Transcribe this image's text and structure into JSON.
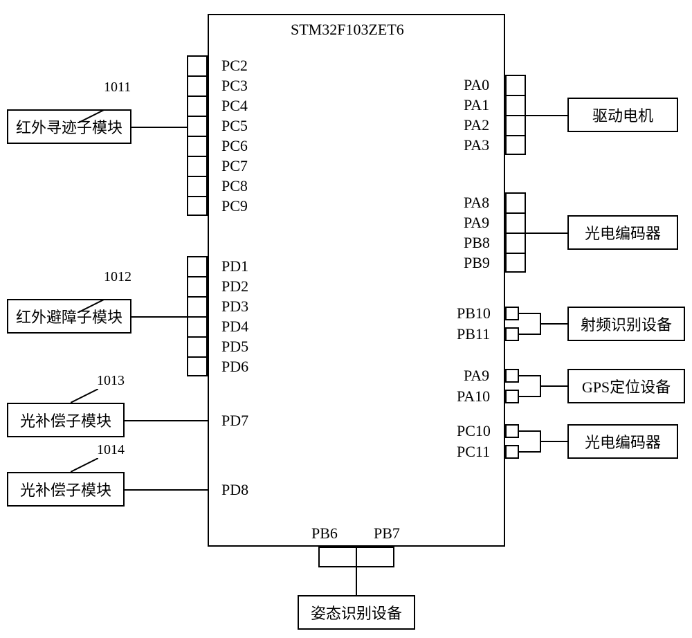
{
  "mcu": {
    "title": "STM32F103ZET6",
    "left_pins_pc": [
      "PC2",
      "PC3",
      "PC4",
      "PC5",
      "PC6",
      "PC7",
      "PC8",
      "PC9"
    ],
    "left_pins_pd_a": [
      "PD1",
      "PD2",
      "PD3",
      "PD4",
      "PD5",
      "PD6"
    ],
    "left_pin_pd7": "PD7",
    "left_pin_pd8": "PD8",
    "right_pins_pa_top": [
      "PA0",
      "PA1",
      "PA2",
      "PA3"
    ],
    "right_pins_enc": [
      "PA8",
      "PA9",
      "PB8",
      "PB9"
    ],
    "right_pins_rfid": [
      "PB10",
      "PB11"
    ],
    "right_pins_gps": [
      "PA9",
      "PA10"
    ],
    "right_pins_enc2": [
      "PC10",
      "PC11"
    ],
    "bottom_pins": [
      "PB6",
      "PB7"
    ]
  },
  "modules": {
    "ir_track": {
      "label": "红外寻迹子模块",
      "ref": "1011"
    },
    "ir_avoid": {
      "label": "红外避障子模块",
      "ref": "1012"
    },
    "light_comp_a": {
      "label": "光补偿子模块",
      "ref": "1013"
    },
    "light_comp_b": {
      "label": "光补偿子模块",
      "ref": "1014"
    },
    "drive_motor": {
      "label": "驱动电机"
    },
    "encoder_a": {
      "label": "光电编码器"
    },
    "rfid": {
      "label": "射频识别设备"
    },
    "gps": {
      "label": "GPS定位设备"
    },
    "encoder_b": {
      "label": "光电编码器"
    },
    "posture": {
      "label": "姿态识别设备"
    }
  }
}
